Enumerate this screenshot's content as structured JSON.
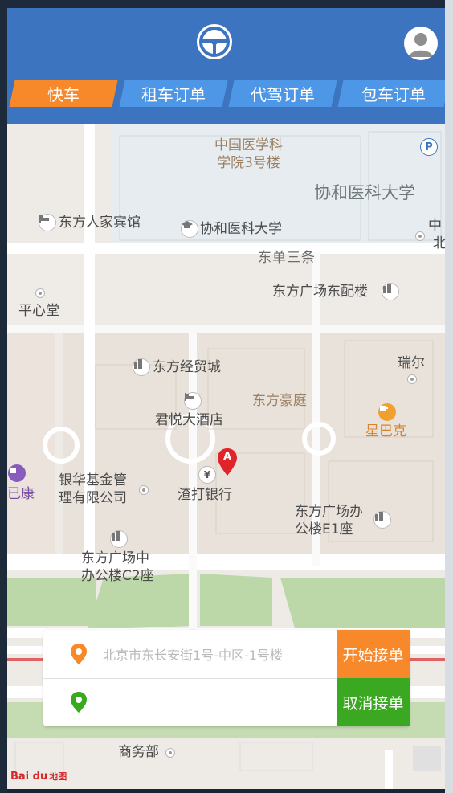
{
  "header": {
    "logo_icon": "steering-wheel-icon",
    "avatar_icon": "user-icon",
    "bg_color": "#3d74bf"
  },
  "tabs": [
    {
      "label": "快车",
      "active": true
    },
    {
      "label": "租车订单",
      "active": false
    },
    {
      "label": "代驾订单",
      "active": false
    },
    {
      "label": "包车订单",
      "active": false
    }
  ],
  "map": {
    "pois": {
      "academy": "中国医学科\n学院3号楼",
      "university_big": "协和医科大学",
      "dongfang_guesthouse": "东方人家宾馆",
      "university": "协和医科大学",
      "street_dongdan": "东单三条",
      "pingxintang": "平心堂",
      "dongfang_plaza_east": "东方广场东配楼",
      "dongfang_trade_city": "东方经贸城",
      "rui_er": "瑞尔",
      "dongfang_haoting": "东方豪庭",
      "grand_hyatt": "君悦大酒店",
      "starbucks": "星巴克",
      "yinhua_fund": "银华基金管\n理有限公司",
      "standard_chartered": "渣打银行",
      "dongfang_office_e1": "东方广场办\n公楼E1座",
      "dongfang_office_c2": "东方广场中\n办公楼C2座",
      "partial_left": "已康",
      "partial_right_top": "中",
      "partial_right_top2": "北",
      "commerce": "商务部"
    },
    "marker_label": "A",
    "attribution": "地图",
    "attribution_brand": "Bai du"
  },
  "order_panel": {
    "start_address_placeholder": "北京市东长安街1号-中区-1号楼",
    "end_address_placeholder": "",
    "start_button": "开始接单",
    "cancel_button": "取消接单",
    "start_color": "#f7892a",
    "end_color": "#3aa820"
  }
}
